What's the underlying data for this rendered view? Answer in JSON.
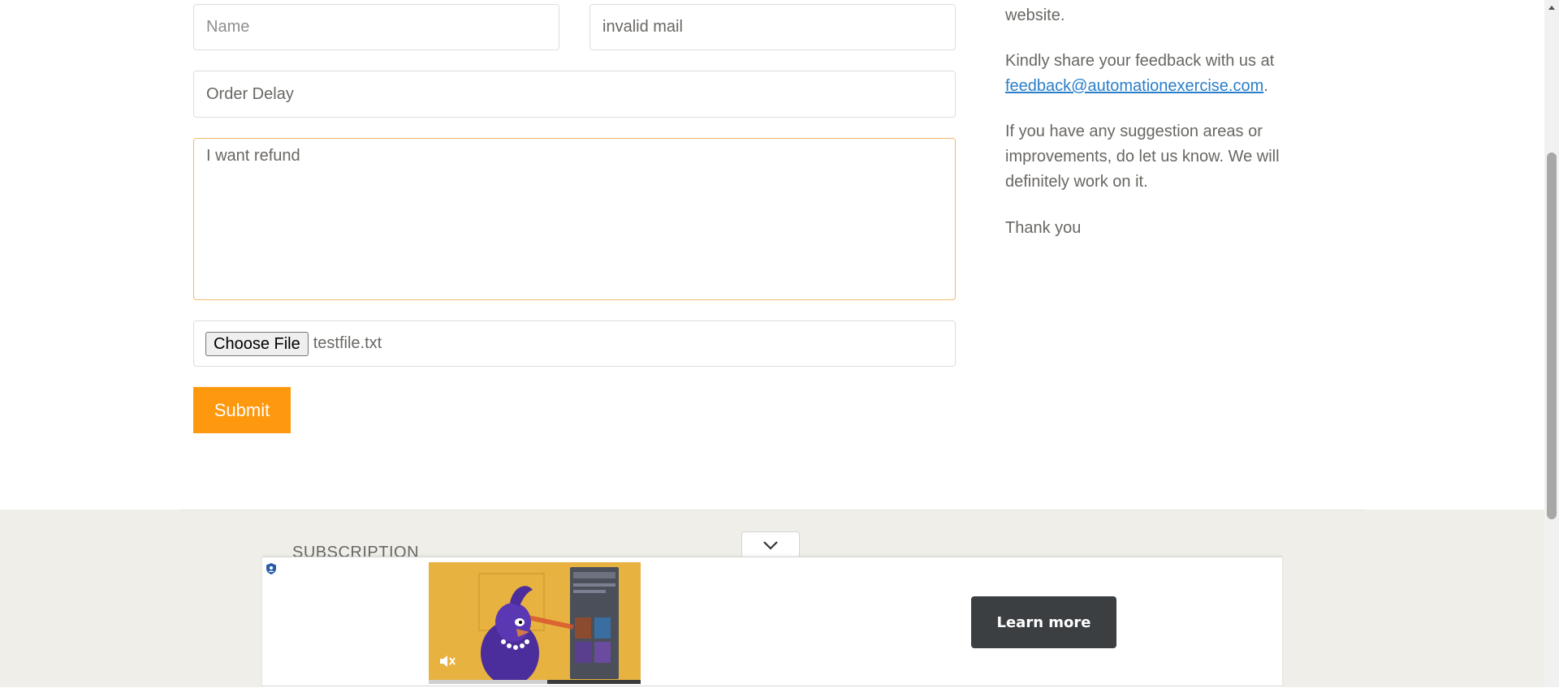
{
  "contact_form": {
    "name_placeholder": "Name",
    "email_value": "invalid mail",
    "subject_value": "Order Delay",
    "message_value": "I want refund",
    "choose_file_label": "Choose File",
    "file_name": "testfile.txt",
    "submit_label": "Submit"
  },
  "feedback": {
    "para1": "website.",
    "para2_text": "Kindly share your feedback with us at",
    "email_link": "feedback@automationexercise.com",
    "para2_end": ".",
    "para3": "If you have any suggestion areas or improvements, do let us know. We will definitely work on it.",
    "para4": "Thank you"
  },
  "footer": {
    "subscription_title": "SUBSCRIPTION"
  },
  "ad": {
    "cta_label": "Learn more",
    "video_progress": 0.56,
    "mute_icon": "mute-icon",
    "collapse_icon": "chevron-down-icon"
  },
  "colors": {
    "accent": "#fe980f",
    "link": "#2a7fca",
    "footer_bg": "#efeee8",
    "ad_image_bg": "#e8b241",
    "cta_bg": "#3b3f42"
  }
}
